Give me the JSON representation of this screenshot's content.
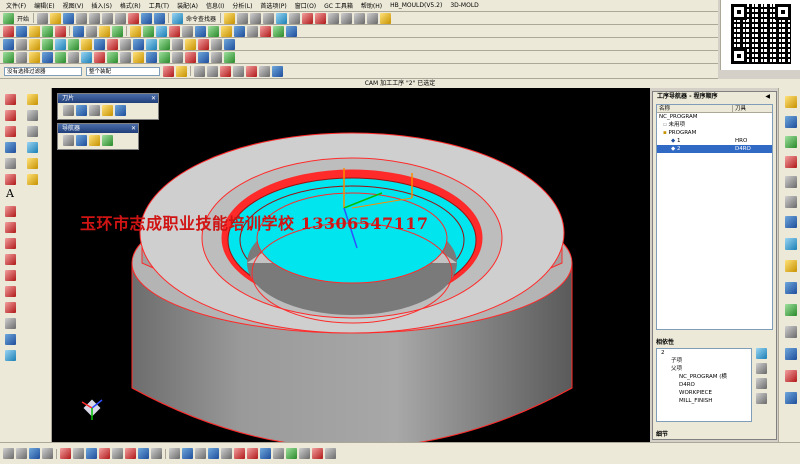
{
  "menubar": [
    "文件(F)",
    "编辑(E)",
    "视图(V)",
    "插入(S)",
    "格式(R)",
    "工具(T)",
    "装配(A)",
    "信息(I)",
    "分析(L)",
    "首选项(P)",
    "窗口(O)",
    "GC 工具箱",
    "帮助(H)",
    "HB_MOULD(V5.2)",
    "3D-MOLD"
  ],
  "toolbar": {
    "start_label": "开始",
    "command_finder_label": "命令查找器"
  },
  "selection_bar": {
    "filter_value": "没有选择过滤器",
    "scope_value": "整个装配"
  },
  "status_title": "CAM 加工工序 \"2\" 已选定",
  "tool_panel": {
    "title": "刀片"
  },
  "navigator_panel": {
    "title": "导航器"
  },
  "watermark": "玉环市志成职业技能培训学校 13306547117",
  "operation_navigator": {
    "title": "工序导航器 - 程序顺序",
    "col_name": "名称",
    "col_tool": "刀具",
    "rows": [
      {
        "name": "NC_PROGRAM",
        "tool": ""
      },
      {
        "name": "未用项",
        "tool": ""
      },
      {
        "name": "PROGRAM",
        "tool": ""
      },
      {
        "name": "1",
        "tool": "HRO"
      },
      {
        "name": "2",
        "tool": "D4RO"
      }
    ]
  },
  "dependencies": {
    "title": "相依性",
    "rows": [
      "2",
      "子项",
      "父项",
      "NC_PROGRAM (横",
      "D4RO",
      "WORKPIECE",
      "MILL_FINISH"
    ]
  },
  "details_label": "细节",
  "colors": {
    "part_gray": "#c8c8c8",
    "cut_cyan": "#00e5ee",
    "edge_red": "#ff2a2a",
    "selection_blue": "#316ac5"
  }
}
